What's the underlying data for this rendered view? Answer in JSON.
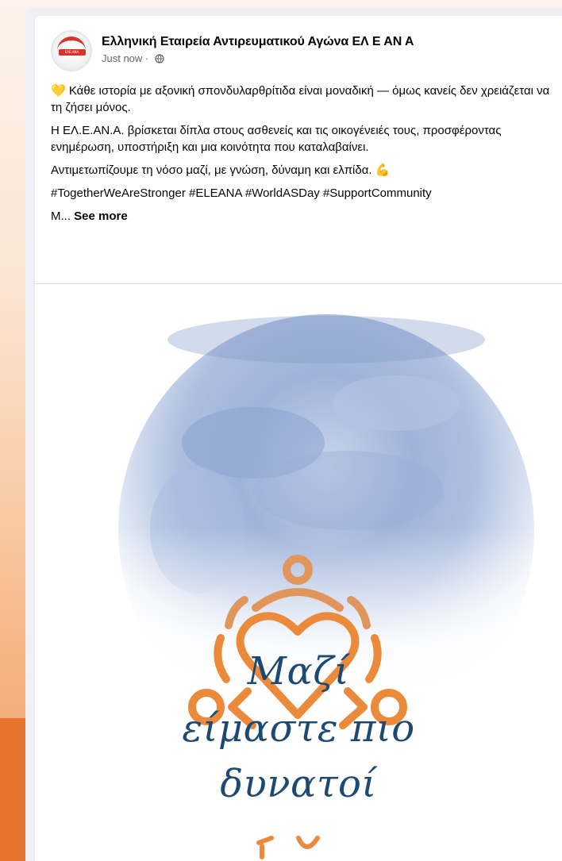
{
  "post": {
    "page_name": "Ελληνική Εταιρεία Αντιρευματικού Αγώνα ΕΛ Ε ΑΝ Α",
    "timestamp": "Just now",
    "separator": " · ",
    "avatar_badge": "ΕΛΕ.ΑΝΑ.",
    "text": {
      "line1": "💛 Κάθε ιστορία με αξονική σπονδυλαρθρίτιδα είναι μοναδική — όμως κανείς δεν χρειάζεται να τη ζήσει μόνος.",
      "line2": "Η ΕΛ.Ε.ΑΝ.Α. βρίσκεται δίπλα στους ασθενείς και τις οικογένειές τους, προσφέροντας ενημέρωση, υποστήριξη και μια κοινότητα που καταλαβαίνει.",
      "line3": "Αντιμετωπίζουμε τη νόσο μαζί, με γνώση, δύναμη και ελπίδα. 💪",
      "hashtags": "#TogetherWeAreStronger #ELEANA #WorldASDay #SupportCommunity",
      "truncated": "M... ",
      "see_more": "See more"
    }
  },
  "image": {
    "slogan_line1": "Μαζί",
    "slogan_line2": "είμαστε πιο",
    "slogan_line3": "δυνατοί"
  },
  "colors": {
    "logo_orange": "#ec8a3c",
    "slogan_blue": "#1d4a73",
    "brand_orange": "#e8732a"
  }
}
